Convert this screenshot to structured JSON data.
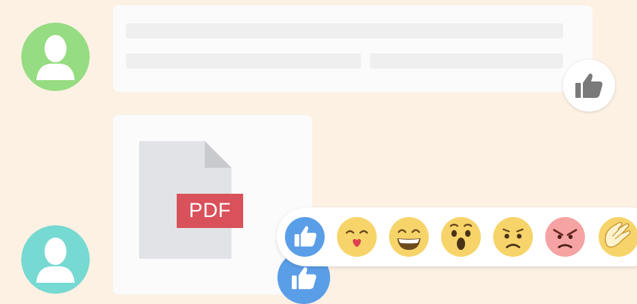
{
  "pdf_label": "PDF",
  "colors": {
    "background": "#fdf1e4",
    "avatar_green": "#96dc82",
    "avatar_teal": "#76d9d2",
    "like_blue": "#5b9ee8",
    "pdf_red": "#d9515a",
    "emoji_yellow": "#f7d46a",
    "angry_red": "#f6a3a3"
  },
  "icons": {
    "avatar_top": "user-silhouette-icon",
    "avatar_bottom": "user-silhouette-icon",
    "message_like": "thumbs-up-icon",
    "file": "pdf-file-icon",
    "reactions": [
      "like",
      "love",
      "haha",
      "wow",
      "sad",
      "angry",
      "yay"
    ]
  }
}
